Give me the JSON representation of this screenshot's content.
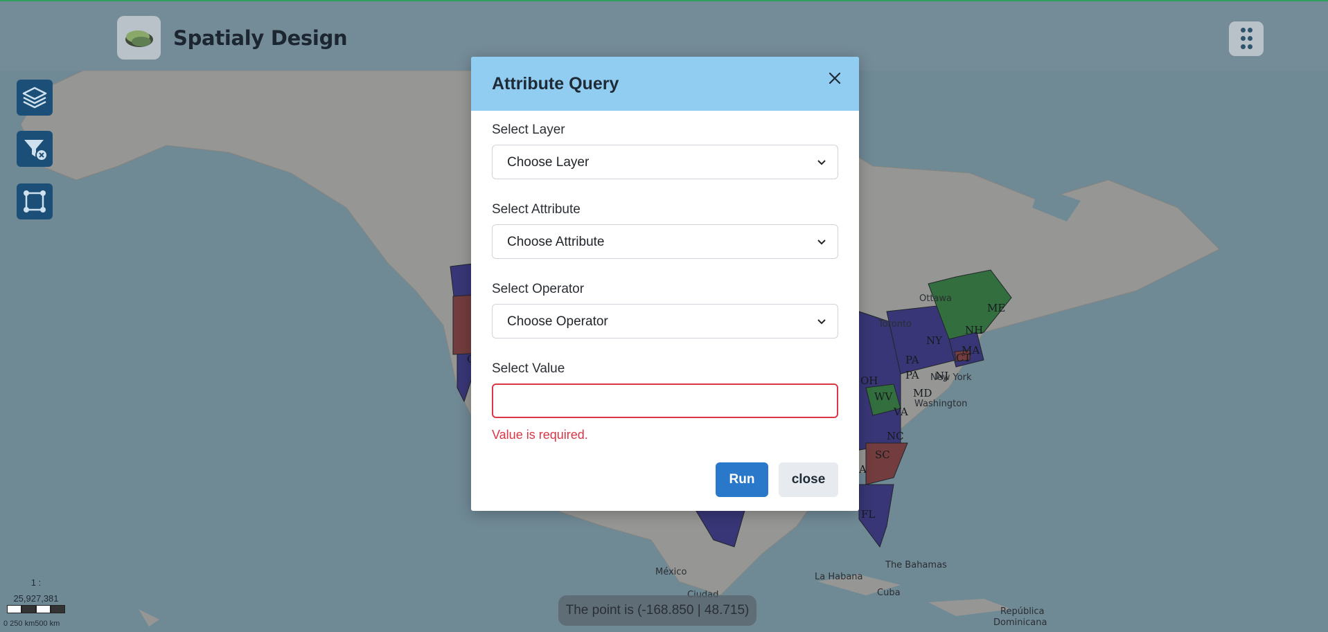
{
  "app": {
    "title": "Spatialy Design"
  },
  "toolbar": [
    {
      "icon": "layers-icon"
    },
    {
      "icon": "clear-filter-icon"
    },
    {
      "icon": "draw-polygon-icon"
    }
  ],
  "map": {
    "place_labels": [
      "Ottawa",
      "Toronto",
      "New York",
      "Washington",
      "México",
      "Ciudad",
      "La Habana",
      "Cuba",
      "The Bahamas",
      "República",
      "Dominicana"
    ],
    "state_labels": [
      "ME",
      "NH",
      "MA",
      "CT",
      "NY",
      "PA",
      "PA",
      "NJ",
      "OH",
      "WV",
      "MD",
      "VA",
      "NC",
      "SC",
      "FL",
      "A",
      "O"
    ],
    "colors": {
      "blue_states": "#4a40a8",
      "green_states": "#43a047",
      "red_states": "#b04a48"
    }
  },
  "scale": {
    "ratio_prefix": "1 :",
    "ratio_value": "25,927,381",
    "labels": "0   250 km500 km"
  },
  "status": {
    "coordinates": "The point is (-168.850 | 48.715)"
  },
  "dialog": {
    "title": "Attribute Query",
    "layer": {
      "label": "Select Layer",
      "value": "Choose Layer"
    },
    "attribute": {
      "label": "Select Attribute",
      "value": "Choose Attribute"
    },
    "operator": {
      "label": "Select Operator",
      "value": "Choose Operator"
    },
    "value": {
      "label": "Select Value",
      "input": "",
      "error": "Value is required."
    },
    "run_label": "Run",
    "close_label": "close"
  }
}
